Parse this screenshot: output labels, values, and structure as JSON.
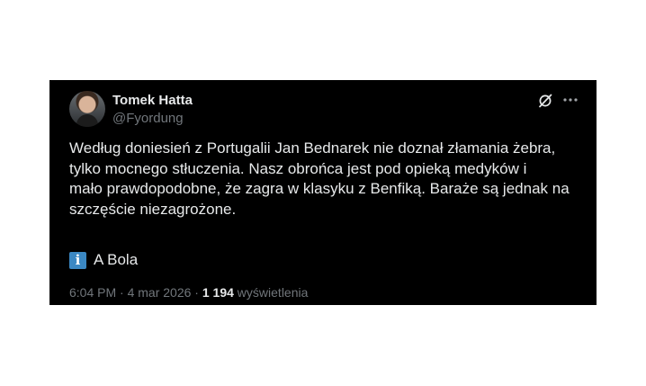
{
  "tweet": {
    "author": {
      "name": "Tomek Hatta",
      "handle": "@Fyordung"
    },
    "text_lines": [
      "Według doniesień z Portugalii Jan Bednarek nie doznał złamania żebra,",
      "tylko mocnego stłuczenia. Nasz obrońca jest pod opieką medyków i",
      "mało prawdopodobne, że zagra w klasyku z Benfiką. Baraże są jednak na",
      "szczęście niezagrożone."
    ],
    "source": {
      "icon": "information-icon",
      "icon_glyph": "i",
      "label": "A Bola"
    },
    "meta": {
      "time": "6:04 PM",
      "sep1": " · ",
      "date": "4 mar 2026",
      "sep2": " · ",
      "views_count": "1 194",
      "views_label": " wyświetlenia"
    },
    "icons": {
      "grok": "grok-icon",
      "more": "more-options-icon"
    },
    "colors": {
      "background": "#000000",
      "text": "#e7e9ea",
      "muted": "#71767b",
      "info_badge": "#3b88c3"
    }
  }
}
